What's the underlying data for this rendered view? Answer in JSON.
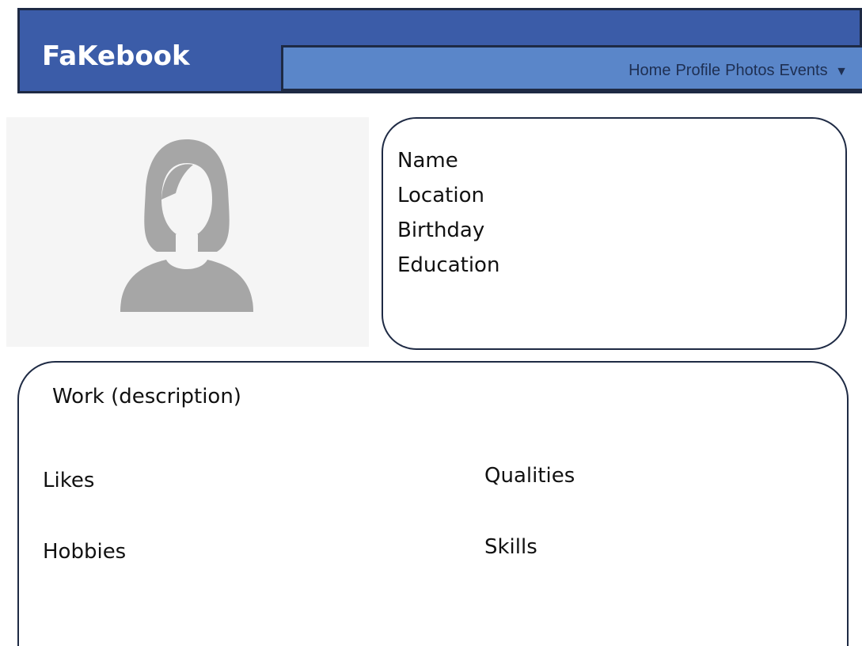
{
  "app": {
    "brand": "FaKebook"
  },
  "nav": {
    "items": [
      "Home",
      "Profile",
      "Photos",
      "Events"
    ],
    "dropdown_glyph": "▼"
  },
  "profile": {
    "avatar_icon": "female-silhouette-icon",
    "fields": [
      "Name",
      "Location",
      "Birthday",
      "Education"
    ]
  },
  "details": {
    "work": "Work (description)",
    "likes": "Likes",
    "hobbies": "Hobbies",
    "qualities": "Qualities",
    "skills": "Skills"
  },
  "colors": {
    "header_bg": "#3b5ca8",
    "navbar_bg": "#5a86c9",
    "border": "#1e2a44",
    "avatar_gray": "#a6a6a6",
    "photo_bg": "#f5f5f5"
  }
}
